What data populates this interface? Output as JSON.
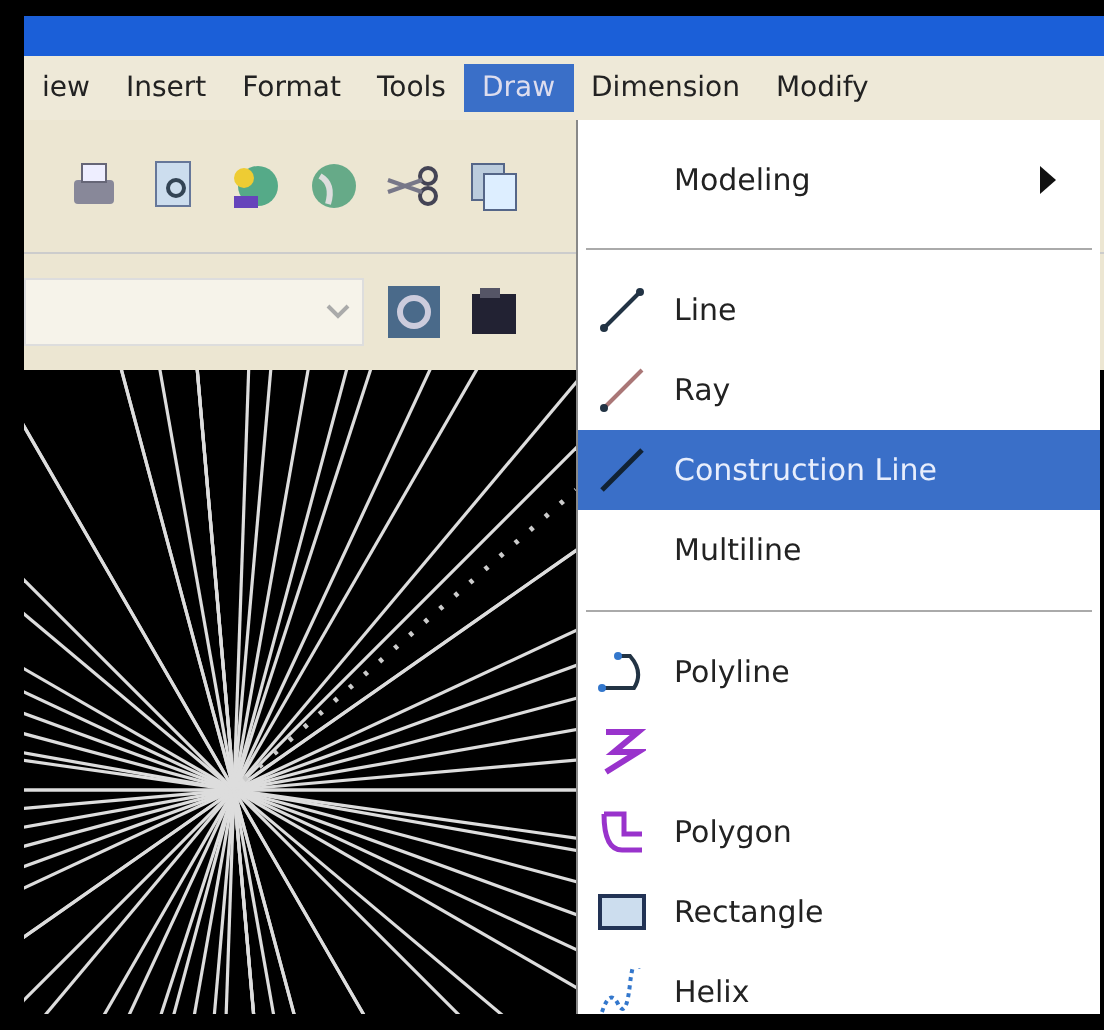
{
  "menu_bar": [
    {
      "label": "iew",
      "selected": false
    },
    {
      "label": "Insert",
      "selected": false
    },
    {
      "label": "Format",
      "selected": false
    },
    {
      "label": "Tools",
      "selected": false
    },
    {
      "label": "Draw",
      "selected": true
    },
    {
      "label": "Dimension",
      "selected": false
    },
    {
      "label": "Modify",
      "selected": false
    }
  ],
  "draw_menu": {
    "items": [
      {
        "kind": "submenu",
        "label": "Modeling",
        "selected": false
      },
      {
        "kind": "separator"
      },
      {
        "kind": "item",
        "label": "Line",
        "selected": false
      },
      {
        "kind": "item",
        "label": "Ray",
        "selected": false
      },
      {
        "kind": "item",
        "label": "Construction Line",
        "selected": true
      },
      {
        "kind": "item",
        "label": "Multiline",
        "selected": false
      },
      {
        "kind": "separator"
      },
      {
        "kind": "item",
        "label": "Polyline",
        "selected": false
      },
      {
        "kind": "item",
        "selected": false
      },
      {
        "kind": "item",
        "label": "Polygon",
        "selected": false
      },
      {
        "kind": "item",
        "label": "Rectangle",
        "selected": false
      },
      {
        "kind": "item",
        "label": "Helix",
        "selected": false
      }
    ]
  }
}
